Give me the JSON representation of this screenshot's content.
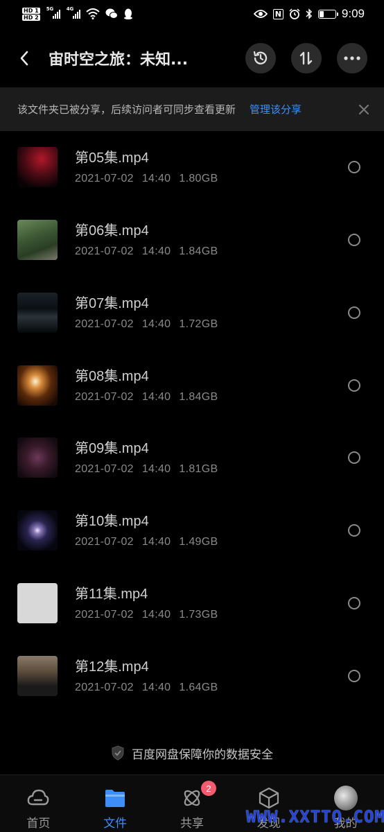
{
  "status_bar": {
    "time": "9:09",
    "sim1": "HD 1",
    "sim2": "HD 2",
    "net1": "5G",
    "net2": "4G",
    "nfc": "N"
  },
  "header": {
    "title": "宙时空之旅：未知...",
    "back_icon": "chevron-left-icon",
    "history_icon": "history-icon",
    "sort_icon": "sort-icon",
    "more_icon": "more-horizontal-icon"
  },
  "notice": {
    "text": "该文件夹已被分享，后续访问者可同步查看更新",
    "link": "管理该分享",
    "close": "×"
  },
  "files": [
    {
      "name": "第05集.mp4",
      "date": "2021-07-02",
      "time": "14:40",
      "size": "1.80GB",
      "thumb": "dark-red-cosmos"
    },
    {
      "name": "第06集.mp4",
      "date": "2021-07-02",
      "time": "14:40",
      "size": "1.84GB",
      "thumb": "forest-man"
    },
    {
      "name": "第07集.mp4",
      "date": "2021-07-02",
      "time": "14:40",
      "size": "1.72GB",
      "thumb": "dark-figures"
    },
    {
      "name": "第08集.mp4",
      "date": "2021-07-02",
      "time": "14:40",
      "size": "1.84GB",
      "thumb": "flame-hand"
    },
    {
      "name": "第09集.mp4",
      "date": "2021-07-02",
      "time": "14:40",
      "size": "1.81GB",
      "thumb": "nebula"
    },
    {
      "name": "第10集.mp4",
      "date": "2021-07-02",
      "time": "14:40",
      "size": "1.49GB",
      "thumb": "galaxy"
    },
    {
      "name": "第11集.mp4",
      "date": "2021-07-02",
      "time": "14:40",
      "size": "1.73GB",
      "thumb": "blank"
    },
    {
      "name": "第12集.mp4",
      "date": "2021-07-02",
      "time": "14:40",
      "size": "1.64GB",
      "thumb": "portrait"
    }
  ],
  "safety_note": "百度网盘保障你的数据安全",
  "nav": [
    {
      "label": "首页",
      "icon": "cloud-icon",
      "active": false
    },
    {
      "label": "文件",
      "icon": "folder-icon",
      "active": true
    },
    {
      "label": "共享",
      "icon": "share-orbit-icon",
      "active": false,
      "badge": "2"
    },
    {
      "label": "发现",
      "icon": "discover-cube-icon",
      "active": false
    },
    {
      "label": "我的",
      "icon": "avatar-icon",
      "active": false
    }
  ],
  "watermark": "WWW.XXTTQ.COM",
  "colors": {
    "background": "#000000",
    "accent": "#3e8ef7",
    "badge": "#f25c6e",
    "notice_bg": "#1c1c1c"
  }
}
